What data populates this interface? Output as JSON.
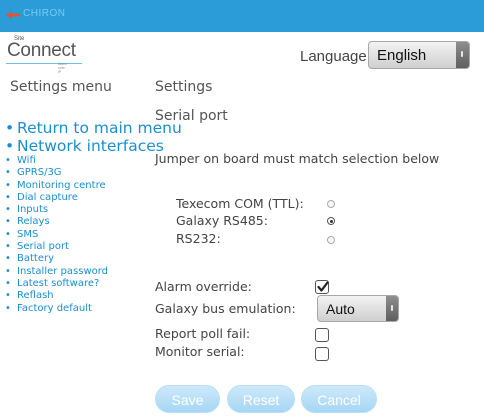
{
  "header": {
    "brand": "CHIRON",
    "product_small": "Site",
    "product": "Connect",
    "tagline": "Alarm over IP",
    "accent_color": "#2b9cd8"
  },
  "language": {
    "label": "Language:",
    "selected": "English"
  },
  "sidebar": {
    "title": "Settings menu",
    "items": [
      {
        "label": "Return to main menu",
        "size": "large"
      },
      {
        "label": "Network interfaces",
        "size": "large"
      },
      {
        "label": "Wifi",
        "size": "small"
      },
      {
        "label": "GPRS/3G",
        "size": "small"
      },
      {
        "label": "Monitoring centre",
        "size": "small"
      },
      {
        "label": "Dial capture",
        "size": "small"
      },
      {
        "label": "Inputs",
        "size": "small"
      },
      {
        "label": "Relays",
        "size": "small"
      },
      {
        "label": "SMS",
        "size": "small"
      },
      {
        "label": "Serial port",
        "size": "small"
      },
      {
        "label": "Battery",
        "size": "small"
      },
      {
        "label": "Installer password",
        "size": "small"
      },
      {
        "label": "Latest software?",
        "size": "small"
      },
      {
        "label": "Reflash",
        "size": "small"
      },
      {
        "label": "Factory default",
        "size": "small"
      }
    ]
  },
  "main": {
    "title": "Settings",
    "section": "Serial port",
    "jumper_note": "Jumper on board must match selection below",
    "port_options": [
      {
        "label": "Texecom COM (TTL):",
        "selected": false
      },
      {
        "label": "Galaxy RS485:",
        "selected": true
      },
      {
        "label": "RS232:",
        "selected": false
      }
    ],
    "alarm_override": {
      "label": "Alarm override:",
      "checked": true
    },
    "bus_emulation": {
      "label": "Galaxy bus emulation:",
      "selected": "Auto"
    },
    "report_poll_fail": {
      "label": "Report poll fail:",
      "checked": false
    },
    "monitor_serial": {
      "label": "Monitor serial:",
      "checked": false
    },
    "buttons": {
      "save": "Save",
      "reset": "Reset",
      "cancel": "Cancel"
    }
  }
}
